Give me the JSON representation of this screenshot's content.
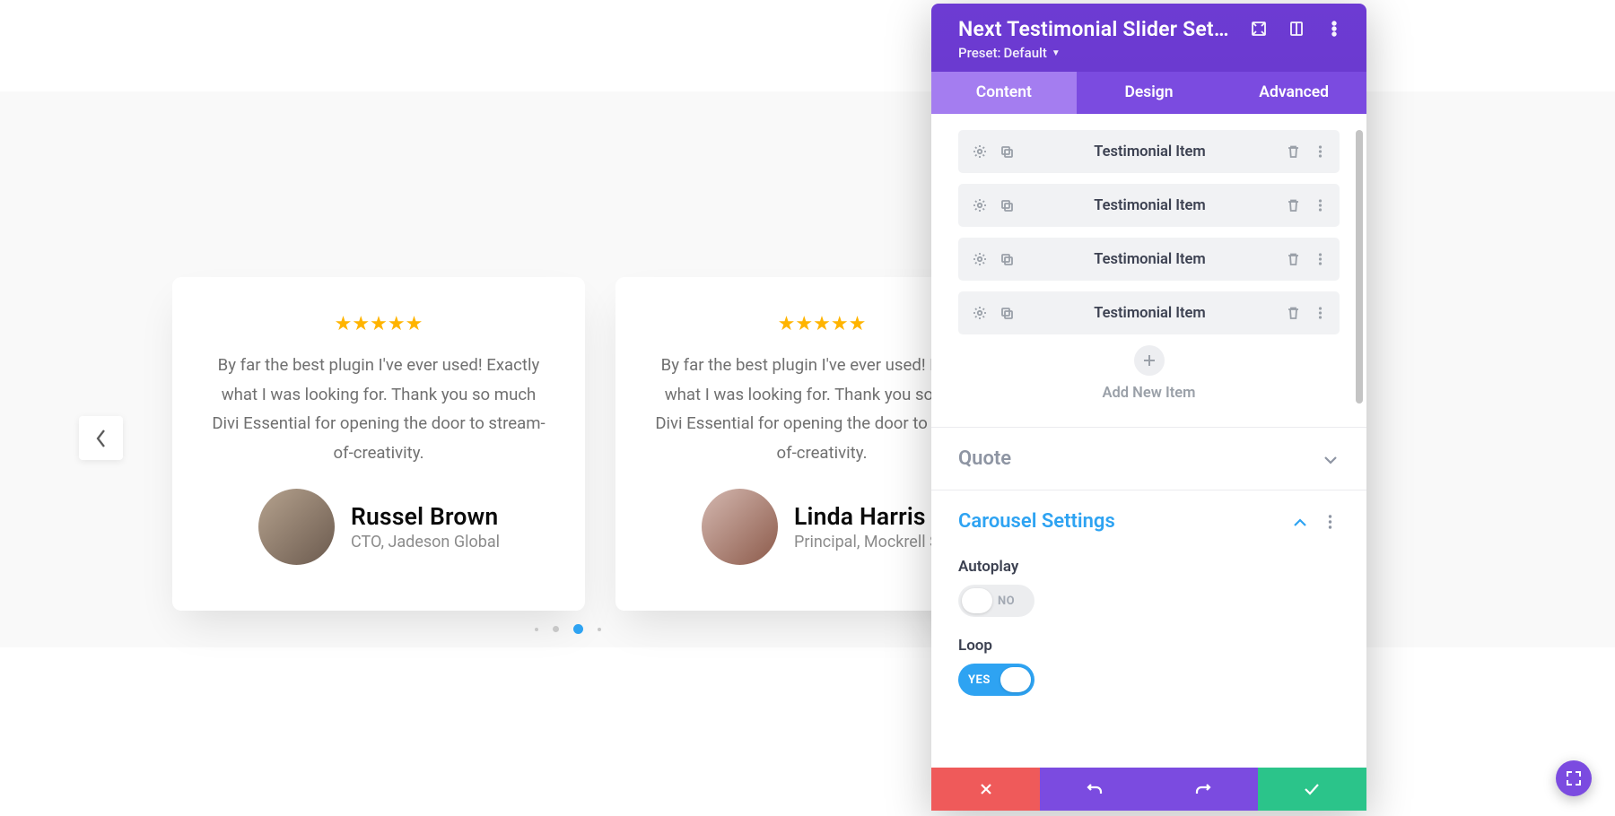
{
  "preview": {
    "testimonials": [
      {
        "quote": "By far the best plugin I've ever used! Exactly what I was looking for. Thank you so much Divi Essential for opening the door to stream-of-creativity.",
        "name": "Russel Brown",
        "role": "CTO, Jadeson Global"
      },
      {
        "quote": "By far the best plugin I've ever used! Exactly what I was looking for. Thank you so much Divi Essential for opening the door to stream-of-creativity.",
        "name": "Linda Harris",
        "role": "Principal, Mockrell School"
      },
      {
        "quote": "By far the best plugin I've ever used! Exactly what I was looking for. Thank you so much Divi Essential for opening the door to stream-of-creativity.",
        "name": "",
        "role": ""
      }
    ],
    "active_dot": 2
  },
  "panel": {
    "title": "Next Testimonial Slider Sett…",
    "preset_label": "Preset:",
    "preset_value": "Default",
    "tabs": {
      "content": "Content",
      "design": "Design",
      "advanced": "Advanced"
    },
    "active_tab": "content",
    "items": [
      {
        "label": "Testimonial Item"
      },
      {
        "label": "Testimonial Item"
      },
      {
        "label": "Testimonial Item"
      },
      {
        "label": "Testimonial Item"
      }
    ],
    "add_label": "Add New Item",
    "sections": {
      "quote": {
        "title": "Quote",
        "open": false
      },
      "carousel": {
        "title": "Carousel Settings",
        "open": true,
        "autoplay": {
          "label": "Autoplay",
          "value": false,
          "off_text": "NO"
        },
        "loop": {
          "label": "Loop",
          "value": true,
          "on_text": "YES"
        }
      }
    }
  }
}
